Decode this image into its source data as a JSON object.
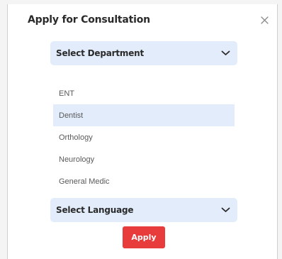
{
  "modal": {
    "title": "Apply for Consultation",
    "close_icon": "close-icon"
  },
  "department_select": {
    "label": "Select Department",
    "icon": "chevron-down-icon",
    "options": [
      {
        "label": "ENT",
        "selected": false
      },
      {
        "label": "Dentist",
        "selected": true
      },
      {
        "label": "Orthology",
        "selected": false
      },
      {
        "label": "Neurology",
        "selected": false
      },
      {
        "label": "General Medic",
        "selected": false
      }
    ]
  },
  "language_select": {
    "label": "Select Language",
    "icon": "chevron-down-icon"
  },
  "apply_button": {
    "label": "Apply"
  },
  "colors": {
    "accent": "#e83b3b",
    "select_bg": "#e2ecfb",
    "text_dark": "#2a2a2a",
    "text_muted": "#5a5a5a"
  }
}
